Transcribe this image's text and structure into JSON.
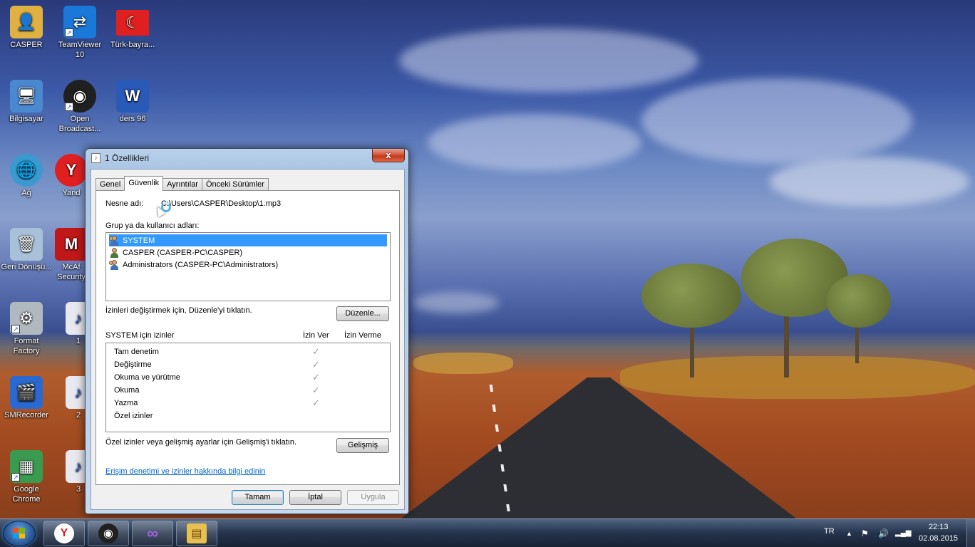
{
  "desktop": {
    "icons": [
      {
        "label": "CASPER",
        "icon": "user-folder-icon",
        "color": "#e0b040"
      },
      {
        "label": "TeamViewer 10",
        "icon": "teamviewer-icon",
        "color": "#1a78d8"
      },
      {
        "label": "Türk-bayra...",
        "icon": "turkish-flag-icon",
        "color": "#e02020"
      },
      {
        "label": "Bilgisayar",
        "icon": "computer-icon",
        "color": "#4a88d0"
      },
      {
        "label": "Open Broadcast...",
        "icon": "obs-icon",
        "color": "#202020"
      },
      {
        "label": "ders 96",
        "icon": "word-document-icon",
        "color": "#2a5ab8"
      },
      {
        "label": "Ağ",
        "icon": "network-icon",
        "color": "#3a9ad0"
      },
      {
        "label": "Yand",
        "icon": "yandex-icon",
        "color": "#e02020"
      },
      {
        "label": "Geri Dönüşü...",
        "icon": "recycle-bin-icon",
        "color": "#a8c0d8"
      },
      {
        "label": "McAf Security",
        "icon": "mcafee-icon",
        "color": "#c01818"
      },
      {
        "label": "Format Factory",
        "icon": "format-factory-icon",
        "color": "#b0b8c0"
      },
      {
        "label": "1",
        "icon": "mp3-file-icon",
        "color": "#e8e8f0"
      },
      {
        "label": "SMRecorder",
        "icon": "smrecorder-icon",
        "color": "#2a6ad0"
      },
      {
        "label": "2",
        "icon": "mp3-file-icon",
        "color": "#e8e8f0"
      },
      {
        "label": "Google Chrome",
        "icon": "chrome-icon",
        "color": "#3a9a50"
      },
      {
        "label": "3",
        "icon": "mp3-file-icon",
        "color": "#e8e8f0"
      }
    ]
  },
  "dialog": {
    "title": "1 Özellikleri",
    "close_label": "x",
    "tabs": [
      "Genel",
      "Güvenlik",
      "Ayrıntılar",
      "Önceki Sürümler"
    ],
    "active_tab": "Güvenlik",
    "object_name_label": "Nesne adı:",
    "object_name_value": "C:\\Users\\CASPER\\Desktop\\1.mp3",
    "groups_label": "Grup ya da kullanıcı adları:",
    "groups": [
      {
        "name": "SYSTEM",
        "icon": "group-users-icon",
        "selected": true
      },
      {
        "name": "CASPER (CASPER-PC\\CASPER)",
        "icon": "user-icon",
        "selected": false
      },
      {
        "name": "Administrators (CASPER-PC\\Administrators)",
        "icon": "group-users-icon",
        "selected": false
      }
    ],
    "change_hint": "İzinleri değiştirmek için, Düzenle'yi tıklatın.",
    "edit_button": "Düzenle...",
    "permissions_title": "SYSTEM için izinler",
    "allow_header": "İzin Ver",
    "deny_header": "İzin Verme",
    "permissions": [
      {
        "name": "Tam denetim",
        "allow": true,
        "deny": false
      },
      {
        "name": "Değiştirme",
        "allow": true,
        "deny": false
      },
      {
        "name": "Okuma ve yürütme",
        "allow": true,
        "deny": false
      },
      {
        "name": "Okuma",
        "allow": true,
        "deny": false
      },
      {
        "name": "Yazma",
        "allow": true,
        "deny": false
      },
      {
        "name": "Özel izinler",
        "allow": false,
        "deny": false
      }
    ],
    "advanced_hint": "Özel izinler veya gelişmiş ayarlar için Gelişmiş'i tıklatın.",
    "advanced_button": "Gelişmiş",
    "help_link": "Erişim denetimi ve izinler hakkında bilgi edinin",
    "ok_button": "Tamam",
    "cancel_button": "İptal",
    "apply_button": "Uygula"
  },
  "taskbar": {
    "pinned": [
      {
        "icon": "yandex-browser-icon",
        "color": "#e02020",
        "glyph": "Y"
      },
      {
        "icon": "obs-icon",
        "color": "#202020",
        "glyph": "◉"
      },
      {
        "icon": "visual-studio-icon",
        "color": "#7a3ab8",
        "glyph": "∞"
      },
      {
        "icon": "file-explorer-icon",
        "color": "#e8c050",
        "glyph": "▤"
      }
    ],
    "language": "TR",
    "time": "22:13",
    "date": "02.08.2015"
  }
}
